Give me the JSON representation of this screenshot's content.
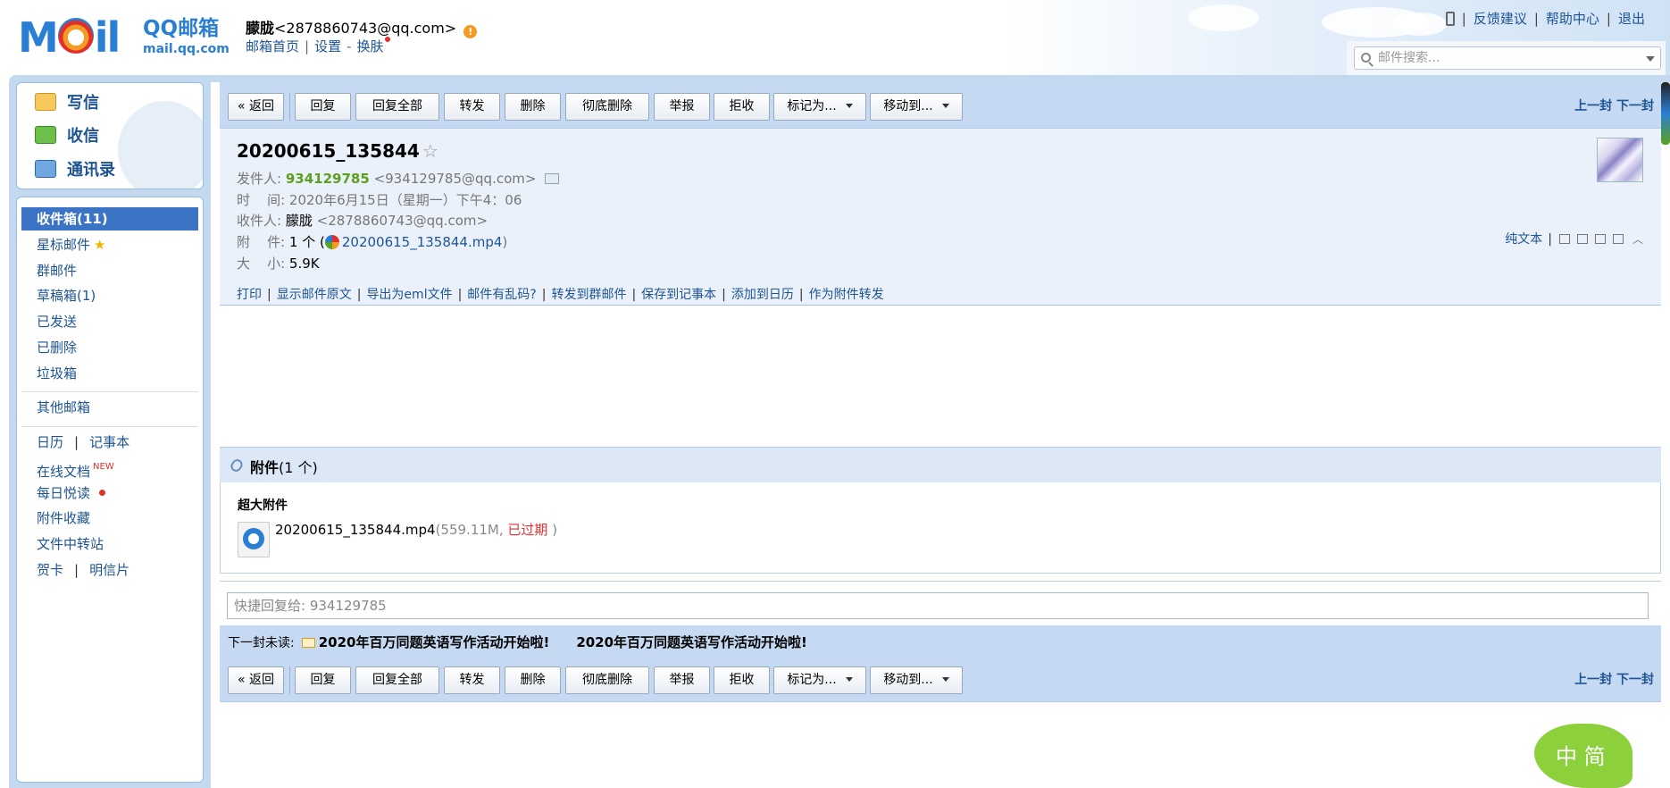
{
  "header": {
    "logo_brand": "QQ邮箱",
    "logo_domain": "mail.qq.com",
    "user_name": "朦胧",
    "user_email": "<2878860743@qq.com>",
    "warn_glyph": "!",
    "links": {
      "home": "邮箱首页",
      "settings": "设置",
      "skin": "换肤"
    },
    "top_links": {
      "feedback": "反馈建议",
      "help": "帮助中心",
      "logout": "退出"
    },
    "search_placeholder": "邮件搜索..."
  },
  "sidebar": {
    "actions": {
      "compose": "写信",
      "receive": "收信",
      "contacts": "通讯录"
    },
    "folders": {
      "inbox": "收件箱(11)",
      "starred": "星标邮件",
      "group": "群邮件",
      "drafts": "草稿箱(1)",
      "sent": "已发送",
      "deleted": "已删除",
      "spam": "垃圾箱"
    },
    "other_mailbox": "其他邮箱",
    "tools": {
      "calendar": "日历",
      "notepad": "记事本",
      "docs": "在线文档",
      "docs_badge": "NEW",
      "daily": "每日悦读",
      "attachments": "附件收藏",
      "transfer": "文件中转站",
      "cards": "贺卡",
      "postcard": "明信片"
    }
  },
  "toolbar": {
    "back": "« 返回",
    "reply": "回复",
    "reply_all": "回复全部",
    "forward": "转发",
    "delete": "删除",
    "purge": "彻底删除",
    "report": "举报",
    "reject": "拒收",
    "mark_as": "标记为...",
    "move_to": "移动到...",
    "prev": "上一封",
    "next": "下一封"
  },
  "mail": {
    "subject": "20200615_135844",
    "labels": {
      "from": "发件人:",
      "time": "时    间:",
      "to": "收件人:",
      "attach": "附    件:",
      "size": "大    小:"
    },
    "sender_name": "934129785",
    "sender_email": "<934129785@qq.com>",
    "time": "2020年6月15日（星期一）下午4：06",
    "recipient_name": "朦胧",
    "recipient_email": "<2878860743@qq.com>",
    "attach_count_prefix": "1 个 (",
    "attach_name": "20200615_135844.mp4",
    "attach_suffix": ")",
    "size": "5.9K",
    "plain_text": "纯文本",
    "actions": {
      "print": "打印",
      "raw": "显示邮件原文",
      "export": "导出为eml文件",
      "garbled": "邮件有乱码?",
      "to_group": "转发到群邮件",
      "to_note": "保存到记事本",
      "to_calendar": "添加到日历",
      "as_attach": "作为附件转发"
    }
  },
  "attachments": {
    "title": "附件",
    "count": "(1 个)",
    "section_label": "超大附件",
    "file_name": "20200615_135844.mp4",
    "file_size": "(559.11M,",
    "status": "已过期",
    "close_paren": ")"
  },
  "quick_reply_placeholder": "快捷回复给: 934129785",
  "next_unread": {
    "label": "下一封未读:",
    "subject": "2020年百万同题英语写作活动开始啦!",
    "subject_repeat": "2020年百万同题英语写作活动开始啦!"
  },
  "ime_badge": "中 简",
  "colors": {
    "accent": "#3b74c5",
    "link": "#1e5494",
    "sender": "#5ba11d",
    "expired": "#e0302e",
    "toolbar_bg": "#c5daf2"
  }
}
